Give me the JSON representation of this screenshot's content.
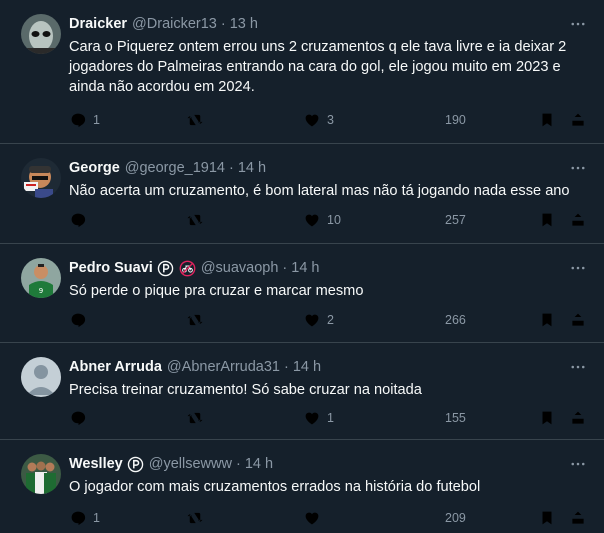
{
  "tweets": [
    {
      "name": "Draicker",
      "handle": "@Draicker13",
      "time": "13 h",
      "text": "Cara o Piquerez ontem errou uns 2 cruzamentos q ele tava livre e ia deixar 2 jogadores do Palmeiras entrando na cara do gol, ele jogou muito em 2023 e ainda não acordou em 2024.",
      "replies": "1",
      "retweets": "",
      "likes": "3",
      "views": "190"
    },
    {
      "name": "George",
      "handle": "@george_1914",
      "time": "14 h",
      "text": "Não acerta um cruzamento, é bom lateral mas não tá jogando nada esse ano",
      "replies": "",
      "retweets": "",
      "likes": "10",
      "views": "257"
    },
    {
      "name": "Pedro Suavi",
      "handle": "@suavaoph",
      "time": "14 h",
      "text": "Só perde o pique pra cruzar e marcar mesmo",
      "replies": "",
      "retweets": "",
      "likes": "2",
      "views": "266"
    },
    {
      "name": "Abner Arruda",
      "handle": "@AbnerArruda31",
      "time": "14 h",
      "text": "Precisa treinar cruzamento! Só sabe cruzar na noitada",
      "replies": "",
      "retweets": "",
      "likes": "1",
      "views": "155"
    },
    {
      "name": "Weslley",
      "handle": "@yellsewww",
      "time": "14 h",
      "text": "O jogador com mais cruzamentos errados na história do futebol",
      "replies": "1",
      "retweets": "",
      "likes": "",
      "views": "209"
    }
  ],
  "icons": {
    "reply": "reply-icon",
    "retweet": "retweet-icon",
    "like": "heart-icon",
    "views": "views-icon",
    "bookmark": "bookmark-icon",
    "share": "share-icon",
    "more": "more-icon",
    "palmeiras": "palmeiras-badge-icon",
    "no-bike": "no-bicycle-icon"
  },
  "colors": {
    "background": "#15202b",
    "text": "#f7f9f9",
    "secondary": "#8b98a5",
    "divider": "#38444d"
  }
}
